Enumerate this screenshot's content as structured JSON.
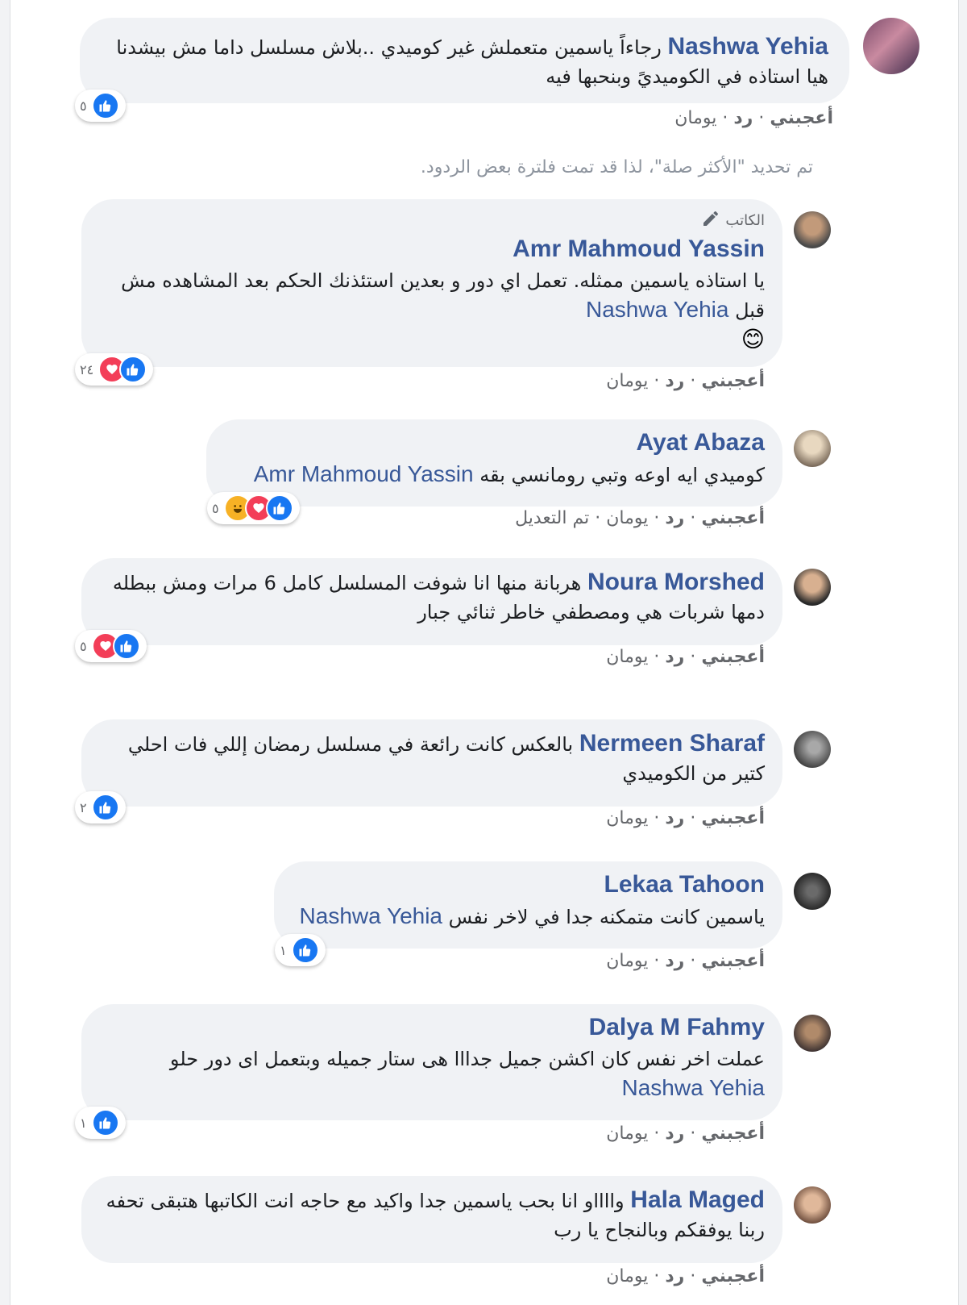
{
  "notice": "تم تحديد \"الأكثر صلة\"، لذا قد تمت فلترة بعض الردود.",
  "actions": {
    "like": "أعجبني",
    "reply": "رد",
    "sep": "·"
  },
  "author_badge": "الكاتب",
  "comments": [
    {
      "name": "Nashwa Yehia",
      "text": "رجاءاً ياسمين متعملش غير كوميدي ..بلاش مسلسل داما مش بيشدنا هيا استاذه في الكوميديً وبنحبها فيه",
      "mention": "",
      "emoji": "",
      "reactions": {
        "count": "٥",
        "types": [
          "like"
        ]
      },
      "time": "يومان",
      "edited": ""
    },
    {
      "name": "Amr Mahmoud Yassin",
      "text": "يا استاذه ياسمين ممثله. تعمل اي دور و بعدين استئذنك الحكم بعد المشاهده مش قبل",
      "mention": "Nashwa Yehia",
      "emoji": "😊",
      "reactions": {
        "count": "٢٤",
        "types": [
          "like",
          "love"
        ]
      },
      "time": "يومان",
      "edited": ""
    },
    {
      "name": "Ayat Abaza",
      "text": "كوميدي ايه اوعه وتبي رومانسي بقه",
      "mention": "Amr Mahmoud Yassin",
      "emoji": "",
      "reactions": {
        "count": "٥",
        "types": [
          "like",
          "love",
          "haha"
        ]
      },
      "time": "يومان",
      "edited": "تم التعديل"
    },
    {
      "name": "Noura Morshed",
      "text": "هربانة منها انا شوفت المسلسل كامل 6 مرات ومش ببطله دمها شربات هي ومصطفي خاطر ثنائي جبار",
      "mention": "",
      "emoji": "",
      "reactions": {
        "count": "٥",
        "types": [
          "like",
          "love"
        ]
      },
      "time": "يومان",
      "edited": ""
    },
    {
      "name": "Nermeen Sharaf",
      "text": "بالعكس كانت رائعة في مسلسل رمضان إللي فات احلي كتير من الكوميدي",
      "mention": "",
      "emoji": "",
      "reactions": {
        "count": "٢",
        "types": [
          "like"
        ]
      },
      "time": "يومان",
      "edited": ""
    },
    {
      "name": "Lekaa Tahoon",
      "text": "ياسمين كانت متمكنه جدا في لاخر نفس",
      "mention": "Nashwa Yehia",
      "emoji": "",
      "reactions": {
        "count": "١",
        "types": [
          "like"
        ]
      },
      "time": "يومان",
      "edited": ""
    },
    {
      "name": "Dalya M Fahmy",
      "text": "عملت اخر نفس كان اكشن جميل جدااا هى ستار جميله وبتعمل اى دور حلو",
      "mention": "Nashwa Yehia",
      "emoji": "",
      "reactions": {
        "count": "١",
        "types": [
          "like"
        ]
      },
      "time": "يومان",
      "edited": ""
    },
    {
      "name": "Hala Maged",
      "text": "وااااو انا بحب ياسمين جدا واكيد مع حاجه انت الكاتبها هتبقى تحفه ربنا يوفقكم وبالنجاح يا رب",
      "mention": "",
      "emoji": "",
      "reactions": {
        "count": "",
        "types": []
      },
      "time": "يومان",
      "edited": ""
    }
  ]
}
